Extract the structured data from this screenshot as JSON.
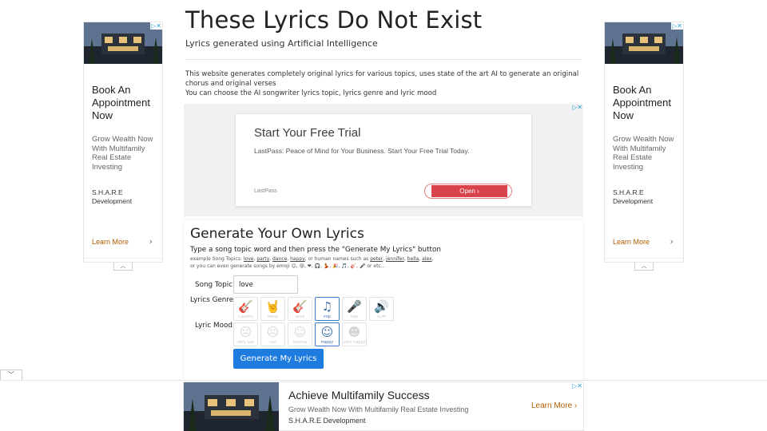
{
  "header": {
    "title": "These Lyrics Do Not Exist",
    "subtitle": "Lyrics generated using Artificial Intelligence",
    "intro_line1": "This website generates completely original lyrics for various topics, uses state of the art AI to generate an original chorus and original verses",
    "intro_line2": "You can choose the AI songwriter lyrics topic, lyrics genre and lyric mood"
  },
  "side_ad": {
    "headline": "Book An Appointment Now",
    "sub": "Grow Wealth Now With Multifamily Real Estate Investing",
    "brand": "S.H.A.R.E Development",
    "learn_more": "Learn More",
    "close_glyph": "▷✕"
  },
  "center_ad": {
    "title": "Start Your Free Trial",
    "desc": "LastPass: Peace of Mind for Your Business. Start Your Free Trial Today.",
    "brand": "LastPass",
    "button": "Open ›",
    "close_glyph": "▷✕"
  },
  "generator": {
    "title": "Generate Your Own Lyrics",
    "instruction": "Type a song topic word and then press the \"Generate My Lyrics\" button",
    "examples_prefix": "example Song Topics:",
    "example_topics": [
      "love",
      "party",
      "dance",
      "happy"
    ],
    "examples_mid": ", or human names such as",
    "example_names": [
      "peter",
      "jennifer",
      "bella",
      "alex"
    ],
    "emoji_line": "or you can even generate songs by emoji 😊, 😰, ❤, 🎧, 💃, 🎉, 🎵, 🎸, 🎤 or etc...",
    "topic_label": "Song Topic:",
    "topic_value": "love",
    "genre_label": "Lyrics Genre:",
    "mood_label": "Lyric Mood:",
    "genres": [
      {
        "label": "Country",
        "icon": "guitar-icon",
        "glyph": "🎸",
        "selected": false
      },
      {
        "label": "Metal",
        "icon": "rock-hand-icon",
        "glyph": "🤘",
        "selected": false
      },
      {
        "label": "Rock",
        "icon": "electric-guitar-icon",
        "glyph": "🎸",
        "selected": false
      },
      {
        "label": "Pop",
        "icon": "music-note-icon",
        "glyph": "♫",
        "selected": true
      },
      {
        "label": "Rap",
        "icon": "microphone-icon",
        "glyph": "🎤",
        "selected": false
      },
      {
        "label": "EDM",
        "icon": "speaker-icon",
        "glyph": "🔊",
        "selected": false
      }
    ],
    "moods": [
      {
        "label": "Very Sad",
        "icon": "very-sad-face-icon",
        "glyph": "☹",
        "selected": false
      },
      {
        "label": "Sad",
        "icon": "sad-face-icon",
        "glyph": "☹",
        "selected": false
      },
      {
        "label": "Neutral",
        "icon": "neutral-face-icon",
        "glyph": "☺",
        "selected": false
      },
      {
        "label": "Happy",
        "icon": "happy-face-icon",
        "glyph": "☺",
        "selected": true
      },
      {
        "label": "Very Happy",
        "icon": "very-happy-face-icon",
        "glyph": "☻",
        "selected": false
      }
    ],
    "button": "Generate My Lyrics"
  },
  "bottom_ad": {
    "headline": "Achieve Multifamily Success",
    "sub": "Grow Wealth Now With Multifamily Real Estate Investing",
    "brand": "S.H.A.R.E Development",
    "learn_more": "Learn More ›",
    "close_glyph": "▷✕"
  },
  "colors": {
    "accent": "#1e7be0",
    "selected_border": "#3a7cc9",
    "ad_button": "#d9434b",
    "learn_more": "#b35c00"
  }
}
